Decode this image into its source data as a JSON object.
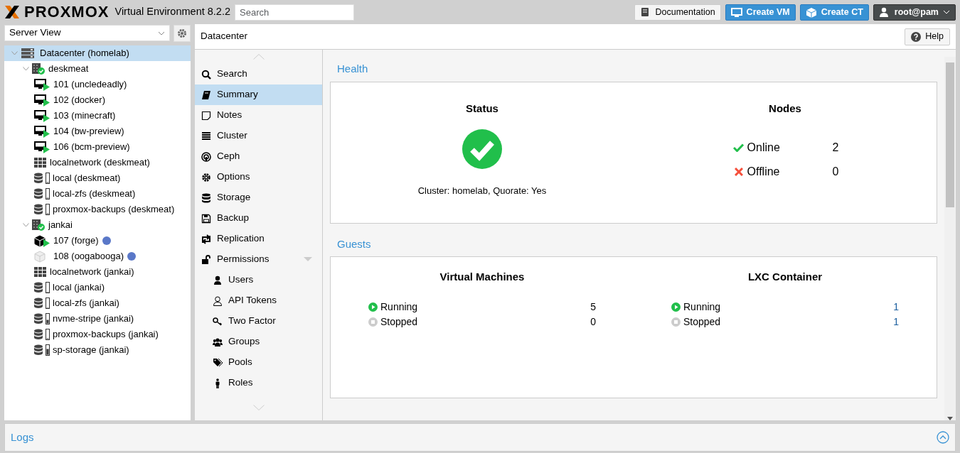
{
  "header": {
    "logo": "PROXMOX",
    "product": "Virtual Environment 8.2.2",
    "search": {
      "placeholder": "Search"
    },
    "buttons": [
      {
        "kind": "doc",
        "label": "Documentation"
      },
      {
        "kind": "vm",
        "label": "Create VM"
      },
      {
        "kind": "ct",
        "label": "Create CT"
      },
      {
        "kind": "user",
        "label": "root@pam"
      }
    ]
  },
  "sidebar": {
    "view": "Server View",
    "tree": [
      {
        "kind": "datacenter",
        "label": "Datacenter (homelab)",
        "selected": true,
        "expanded": true,
        "children": [
          {
            "kind": "node",
            "label": "deskmeat",
            "selected": false,
            "expanded": true,
            "children": [
              {
                "kind": "vm",
                "label": "101 (uncledeadly)",
                "selected": false,
                "running": true
              },
              {
                "kind": "vm",
                "label": "102 (docker)",
                "selected": false,
                "running": true
              },
              {
                "kind": "vm",
                "label": "103 (minecraft)",
                "selected": false,
                "running": true
              },
              {
                "kind": "vm",
                "label": "104 (bw-preview)",
                "selected": false,
                "running": true
              },
              {
                "kind": "vm",
                "label": "106 (bcm-preview)",
                "selected": false,
                "running": true
              },
              {
                "kind": "network",
                "label": "localnetwork (deskmeat)",
                "selected": false
              },
              {
                "kind": "storage",
                "label": "local (deskmeat)",
                "selected": false,
                "level": 0.1
              },
              {
                "kind": "storage",
                "label": "local-zfs (deskmeat)",
                "selected": false,
                "level": 0.05
              },
              {
                "kind": "storage",
                "label": "proxmox-backups (deskmeat)",
                "selected": false,
                "level": 0.1
              }
            ]
          },
          {
            "kind": "node",
            "label": "jankai",
            "selected": false,
            "expanded": true,
            "children": [
              {
                "kind": "ct",
                "label": "107 (forge)",
                "selected": false,
                "running": true,
                "color": "#5a78c8"
              },
              {
                "kind": "ct",
                "label": "108 (oogabooga)",
                "selected": false,
                "running": false,
                "color": "#5a78c8"
              },
              {
                "kind": "network",
                "label": "localnetwork (jankai)",
                "selected": false
              },
              {
                "kind": "storage",
                "label": "local (jankai)",
                "selected": false,
                "level": 0.0
              },
              {
                "kind": "storage",
                "label": "local-zfs (jankai)",
                "selected": false,
                "level": 0.0
              },
              {
                "kind": "storage",
                "label": "nvme-stripe (jankai)",
                "selected": false,
                "level": 0.45
              },
              {
                "kind": "storage",
                "label": "proxmox-backups (jankai)",
                "selected": false,
                "level": 0.1
              },
              {
                "kind": "storage",
                "label": "sp-storage (jankai)",
                "selected": false,
                "level": 0.65
              }
            ]
          }
        ]
      }
    ]
  },
  "breadcrumb": "Datacenter",
  "help": "Help",
  "menu": [
    {
      "kind": "search",
      "label": "Search",
      "selected": false
    },
    {
      "kind": "book",
      "label": "Summary",
      "selected": true
    },
    {
      "kind": "note",
      "label": "Notes",
      "selected": false
    },
    {
      "kind": "server",
      "label": "Cluster",
      "selected": false
    },
    {
      "kind": "ceph",
      "label": "Ceph",
      "selected": false
    },
    {
      "kind": "gear",
      "label": "Options",
      "selected": false
    },
    {
      "kind": "database",
      "label": "Storage",
      "selected": false
    },
    {
      "kind": "floppy",
      "label": "Backup",
      "selected": false
    },
    {
      "kind": "retweet",
      "label": "Replication",
      "selected": false
    },
    {
      "kind": "unlock",
      "label": "Permissions",
      "selected": false,
      "expanded": true,
      "children": [
        {
          "kind": "user",
          "label": "Users",
          "selected": false
        },
        {
          "kind": "userline",
          "label": "API Tokens",
          "selected": false
        },
        {
          "kind": "key",
          "label": "Two Factor",
          "selected": false
        },
        {
          "kind": "users",
          "label": "Groups",
          "selected": false
        },
        {
          "kind": "tags",
          "label": "Pools",
          "selected": false
        },
        {
          "kind": "male",
          "label": "Roles",
          "selected": false
        }
      ]
    }
  ],
  "health": {
    "title": "Health",
    "status_heading": "Status",
    "status_ok": true,
    "cluster": "Cluster: homelab, Quorate: Yes",
    "nodes_heading": "Nodes",
    "nodes": [
      {
        "kind": "online",
        "label": "Online",
        "count": "2"
      },
      {
        "kind": "offline",
        "label": "Offline",
        "count": "0"
      }
    ]
  },
  "guests": {
    "title": "Guests",
    "groups": [
      {
        "heading": "Virtual Machines",
        "rows": [
          {
            "kind": "running",
            "label": "Running",
            "count": "5"
          },
          {
            "kind": "stopped",
            "label": "Stopped",
            "count": "0"
          }
        ]
      },
      {
        "heading": "LXC Container",
        "rows": [
          {
            "kind": "running",
            "label": "Running",
            "count": "1"
          },
          {
            "kind": "stopped",
            "label": "Stopped",
            "count": "1"
          }
        ]
      }
    ]
  },
  "logs": {
    "title": "Logs"
  }
}
